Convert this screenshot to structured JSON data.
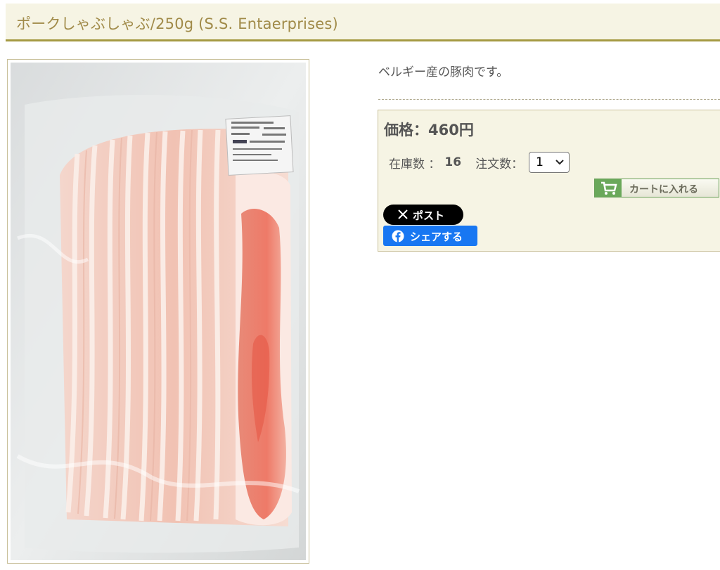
{
  "product": {
    "title": "ポークしゃぶしゃぶ/250g (S.S. Entaerprises)",
    "description": "ベルギー産の豚肉です。"
  },
  "purchase": {
    "price_label": "価格：460円",
    "stock_label": "在庫数 ：",
    "stock_value": "16",
    "order_label": "注文数：",
    "quantity_selected": "1",
    "cart_button_label": "カートに入れる"
  },
  "share": {
    "x_label": "ポスト",
    "facebook_label": "シェアする"
  },
  "icons": {
    "cart": "cart-icon",
    "x": "x-logo-icon",
    "facebook": "facebook-logo-icon",
    "select": "chevron-down-icon"
  },
  "colors": {
    "title_background": "#f6f4e4",
    "title_text": "#a08a48",
    "title_underline": "#a59a42",
    "cart_green": "#6aa85a",
    "facebook_blue": "#1877f2",
    "x_black": "#000000"
  }
}
